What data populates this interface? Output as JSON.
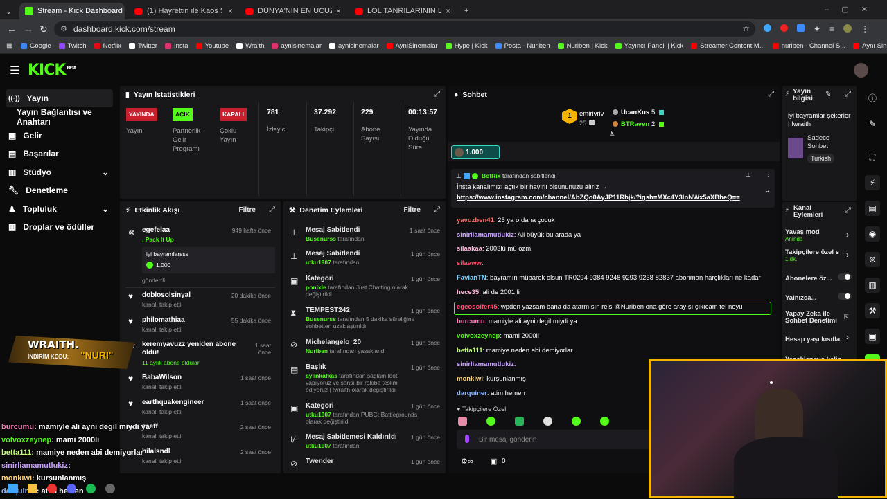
{
  "browser": {
    "tabs": [
      {
        "label": "Stream - Kick Dashboard",
        "icon": "kick-icon"
      },
      {
        "label": "(1) Hayrettin ile Kaos Show - 2...",
        "icon": "youtube-icon"
      },
      {
        "label": "DÜNYA'NIN EN UCUZ ÜLKESİ V...",
        "icon": "youtube-icon"
      },
      {
        "label": "LOL TANRILARININ LANETLEDİ...",
        "icon": "youtube-icon"
      }
    ],
    "url": "dashboard.kick.com/stream",
    "bookmarks": [
      "Google",
      "Twitch",
      "Netflix",
      "Twitter",
      "Insta",
      "Youtube",
      "Wraith",
      "aynisinemalar",
      "aynisinemalar",
      "AyniSinemalar",
      "Hype | Kick",
      "Posta - Nuriben",
      "Nuriben | Kick",
      "Yayıncı Paneli | Kick",
      "Streamer Content M...",
      "nuriben - Channel S...",
      "Aynı Sinemalar - Ça..."
    ]
  },
  "brand": {
    "logo": "KICK",
    "beta": "BETA",
    "accent": "#53fc18"
  },
  "sidebar": {
    "items": [
      {
        "label": "Yayın"
      },
      {
        "label": "Yayın Bağlantısı ve Anahtarı"
      },
      {
        "label": "Gelir"
      },
      {
        "label": "Başarılar"
      },
      {
        "label": "Stüdyo"
      },
      {
        "label": "Denetleme"
      },
      {
        "label": "Topluluk"
      },
      {
        "label": "Droplar ve ödüller"
      }
    ]
  },
  "stats": {
    "title": "Yayın İstatistikleri",
    "items": [
      {
        "badge": "YAYINDA",
        "label": "Yayın"
      },
      {
        "badge": "AÇIK",
        "label": "Partnerlik Gelir Programı"
      },
      {
        "badge": "KAPALI",
        "label": "Çoklu Yayın"
      },
      {
        "value": "781",
        "label": "İzleyici"
      },
      {
        "value": "37.292",
        "label": "Takipçi"
      },
      {
        "value": "229",
        "label": "Abone Sayısı"
      },
      {
        "value": "00:13:57",
        "label": "Yayında Olduğu Süre"
      }
    ]
  },
  "activity": {
    "title": "Etkinlik Akışı",
    "filter": "Filtre",
    "events": [
      {
        "name": "egefelaa",
        "sub": ", Pack It Up",
        "time": "949 hafta önce",
        "gift_msg": "iyi bayramlarsss",
        "gift_amount": "1.000",
        "gift_foot": "gönderdi"
      },
      {
        "name": "doblosolsinyal",
        "sub": "kanalı takip etti",
        "time": "20 dakika önce"
      },
      {
        "name": "philomathiaa",
        "sub": "kanalı takip etti",
        "time": "55 dakika önce"
      },
      {
        "name": "keremyavuzz yeniden abone oldu!",
        "sub": "11 aylık abone oldular",
        "time": "1 saat önce"
      },
      {
        "name": "BabaWilson",
        "sub": "kanalı takip etti",
        "time": "1 saat önce"
      },
      {
        "name": "earthquakengineer",
        "sub": "kanalı takip etti",
        "time": "1 saat önce"
      },
      {
        "name": "zaeff",
        "sub": "kanalı takip etti",
        "time": "2 saat önce"
      },
      {
        "name": "hilalsndl",
        "sub": "kanalı takip etti",
        "time": "2 saat önce"
      }
    ]
  },
  "moderation": {
    "title": "Denetim Eylemleri",
    "filter": "Filtre",
    "actions": [
      {
        "title": "Mesaj Sabitlendi",
        "user": "Busenurss",
        "rest": " tarafından",
        "time": "1 saat önce"
      },
      {
        "title": "Mesaj Sabitlendi",
        "user": "utku1907",
        "rest": " tarafından",
        "time": "1 gün önce"
      },
      {
        "title": "Kategori",
        "user": "ponixle",
        "rest": " tarafından Just Chatting olarak değiştirildi",
        "time": "1 gün önce"
      },
      {
        "title": "TEMPEST242",
        "user": "Busenurss",
        "rest": " tarafından 5 dakika süreliğine sohbetten uzaklaştırıldı",
        "time": "1 gün önce"
      },
      {
        "title": "Michelangelo_20",
        "user": "Nuriben",
        "rest": " tarafından yasaklandı",
        "time": "1 gün önce"
      },
      {
        "title": "Başlık",
        "user": "aylinkafkas",
        "rest": " tarafından sağlam loot yapıyoruz ve şansı bir rakibe teslim ediyoruz | !wraith olarak değiştirildi",
        "time": "1 gün önce"
      },
      {
        "title": "Kategori",
        "user": "utku1907",
        "rest": " tarafından PUBG: Battlegrounds olarak değiştirildi",
        "time": "1 gün önce"
      },
      {
        "title": "Mesaj Sabitlemesi Kaldırıldı",
        "user": "utku1907",
        "rest": " tarafından",
        "time": "1 gün önce"
      },
      {
        "title": "Twender",
        "user": "",
        "rest": "",
        "time": "1 gün önce"
      }
    ]
  },
  "chat": {
    "title": "Sohbet",
    "leaderboard": [
      {
        "rank": "1",
        "name": "emirivriv",
        "count": "25"
      },
      {
        "name": "UcanKus",
        "count": "5"
      },
      {
        "name": "BTRaven",
        "count": "2"
      }
    ],
    "gift_pill": "1.000",
    "pinned": {
      "by": "BotRix",
      "by_suffix": "tarafından sabitlendi",
      "text": "İnsta kanalımızı açtık bir hayırlı olsununuzu alırız →",
      "link": "https://www.instagram.com/channel/AbZQo0AyJP11Rbjk/?igsh=MXc4Y3lnNWx5aXBheQ=="
    },
    "messages": [
      {
        "user": "yavuzben41",
        "color": "#ff6b6b",
        "text": ": 25 ya o daha çocuk"
      },
      {
        "user": "sinirliamamutlukiz",
        "color": "#c9a0ff",
        "text": ": Ali büyük bu arada ya"
      },
      {
        "user": "silaakaa",
        "color": "#ffb3d9",
        "text": ": 2003lü mü ozm"
      },
      {
        "user": "silaaww",
        "color": "#ff4d6d",
        "text": ":"
      },
      {
        "user": "FavianTN",
        "color": "#7fd3ff",
        "text": ": bayramın mübarek olsun TR0294 9384 9248 9293 9238 82837 abonman harçlıkları ne kadar"
      },
      {
        "user": "hece35",
        "color": "#ffb3d9",
        "text": ": ali de 2001 li"
      },
      {
        "user": "egeosolfer45",
        "color": "#ff4d6d",
        "text": ": wpden yazsam bana da atarmısın reis @Nuriben ona göre arayışı çıkıcam tel noyu"
      },
      {
        "user": "burcumu",
        "color": "#ff7ab8",
        "text": ": mamiyle ali ayni degil miydi ya"
      },
      {
        "user": "volvoxzeynep",
        "color": "#53fc18",
        "text": ": mami 2000li"
      },
      {
        "user": "betta111",
        "color": "#c4ff7a",
        "text": ": mamiye neden abi demiyorlar"
      },
      {
        "user": "sinirliamamutlukiz",
        "color": "#c9a0ff",
        "text": ":"
      },
      {
        "user": "monkiwi",
        "color": "#ffd27a",
        "text": ": kurşunlanmış"
      },
      {
        "user": "darquiner",
        "color": "#8ab4ff",
        "text": ": atim hemen"
      }
    ],
    "followers_only": "Takipçilere Özel",
    "input_placeholder": "Bir mesaj gönderin",
    "points": "0"
  },
  "stream_info": {
    "title": "Yayın bilgisi",
    "stream_title": "iyi bayramlar şekerler | !wraith",
    "category": "Sadece Sohbet",
    "language": "Turkish"
  },
  "channel_actions": {
    "title": "Kanal Eylemleri",
    "items": [
      {
        "label": "Yavaş mod",
        "sub": "Anında"
      },
      {
        "label": "Takipçilere özel s",
        "sub": "1 dk."
      },
      {
        "label": "Abonelere öz..."
      },
      {
        "label": "Yalnızca..."
      },
      {
        "label": "Yapay Zeka ile Sohbet Denetimi"
      },
      {
        "label": "Hesap yaşı kısıtla"
      },
      {
        "label": "Yasaklanmış kelin"
      }
    ]
  },
  "overlay": {
    "sponsor": "WRAITH.",
    "code_label": "İNDİRİM KODU:",
    "code": "\"NURI\"",
    "chat": [
      {
        "user": "burcumu",
        "text": ": mamiyle ali ayni degil miydi ya"
      },
      {
        "user": "volvoxzeynep",
        "text": ": mami 2000li"
      },
      {
        "user": "betta111",
        "text": ": mamiye neden abi demiyorlar"
      },
      {
        "user": "sinirliamamutlukiz",
        "text": ":"
      },
      {
        "user": "monkiwi",
        "text": ": kurşunlanmış"
      },
      {
        "user": "darquiner",
        "text": ": atim hemen"
      }
    ]
  }
}
